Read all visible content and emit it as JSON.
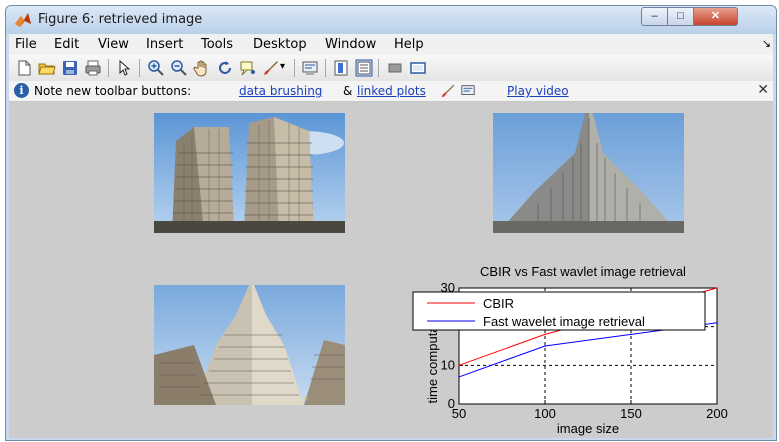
{
  "window": {
    "title": "Figure 6: retrieved image",
    "controls": {
      "minimize": "–",
      "maximize": "□",
      "close": "✕"
    }
  },
  "menubar": {
    "items": [
      "File",
      "Edit",
      "View",
      "Insert",
      "Tools",
      "Desktop",
      "Window",
      "Help"
    ],
    "overflow": "↘"
  },
  "toolbar": {
    "buttons": [
      "new-figure-icon",
      "open-icon",
      "save-icon",
      "print-icon",
      "pointer-icon",
      "zoom-in-icon",
      "zoom-out-icon",
      "pan-icon",
      "rotate-icon",
      "data-cursor-icon",
      "brush-icon",
      "link-icon",
      "colorbar-icon",
      "legend-icon",
      "hide-tools-icon",
      "show-tools-icon"
    ]
  },
  "infobar": {
    "note": "Note new toolbar buttons:",
    "link_brushing": "data brushing",
    "amp": "&",
    "link_plots": "linked plots",
    "link_video": "Play video",
    "close": "✕"
  },
  "colors": {
    "accent_link": "#1a3fb8",
    "series_cbir": "#ff0000",
    "series_fast": "#0000ff",
    "canvas_bg": "#cccccc"
  },
  "chart_data": {
    "type": "line",
    "title": "CBIR vs Fast wavlet image retrieval",
    "xlabel": "image size",
    "ylabel": "time computation",
    "xlim": [
      50,
      200
    ],
    "ylim": [
      0,
      30
    ],
    "xticks": [
      50,
      100,
      150,
      200
    ],
    "yticks": [
      0,
      10,
      20,
      30
    ],
    "grid": true,
    "legend_position": "top-left",
    "series": [
      {
        "name": "CBIR",
        "color": "#ff0000",
        "x": [
          50,
          100,
          150,
          200
        ],
        "y": [
          10,
          18,
          24,
          30
        ]
      },
      {
        "name": "Fast wavelet image retrieval",
        "color": "#0000ff",
        "x": [
          50,
          100,
          150,
          200
        ],
        "y": [
          7,
          15,
          18,
          21
        ]
      }
    ]
  }
}
